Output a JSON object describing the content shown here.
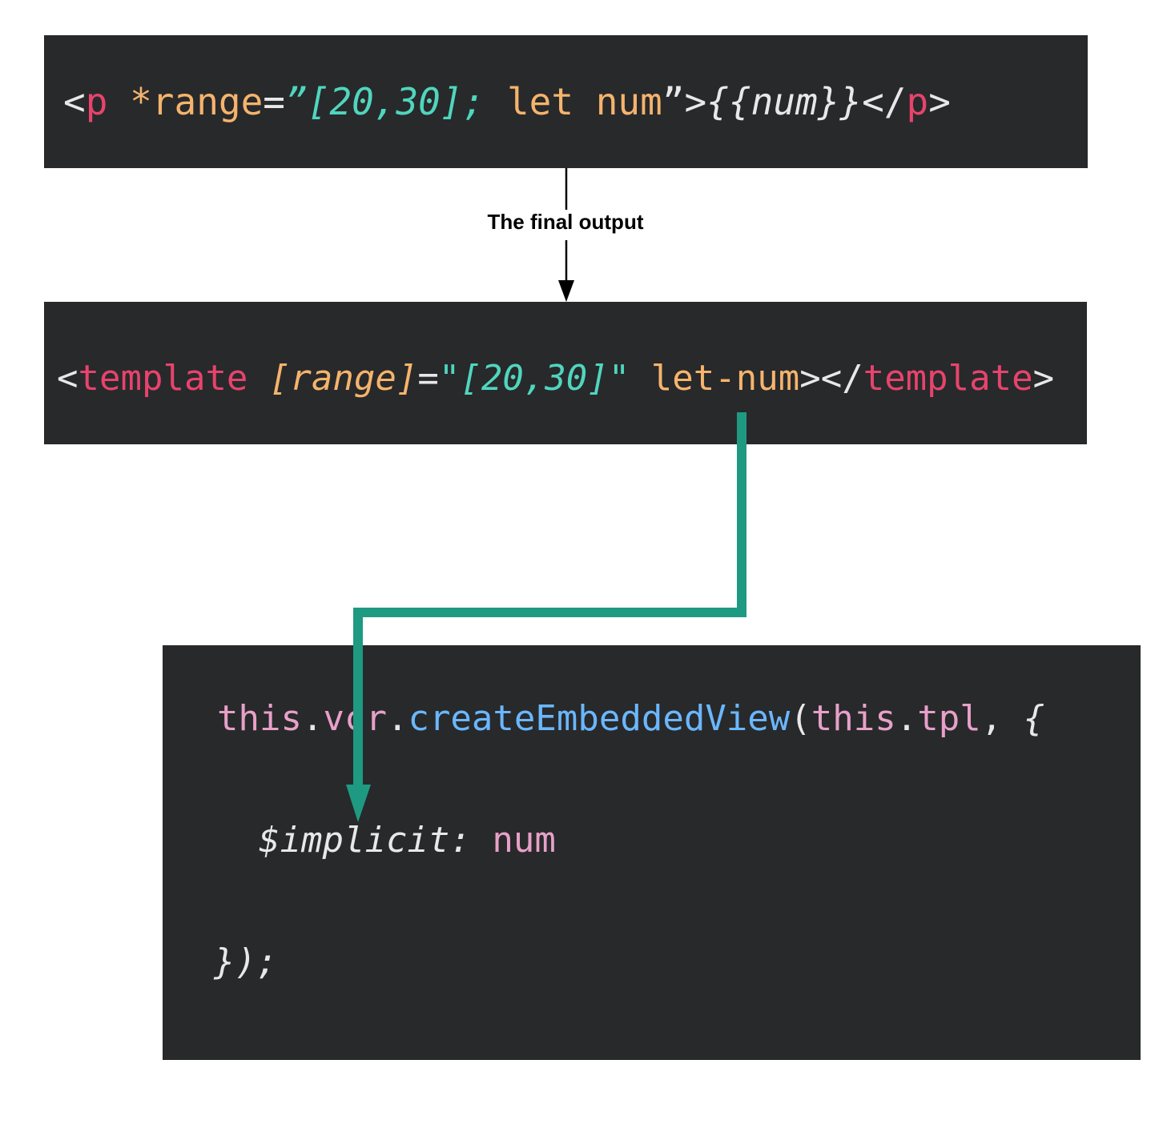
{
  "colors": {
    "background": "#ffffff",
    "code_bg": "#28292b",
    "punct": "#e8e8e8",
    "tag": "#e8436d",
    "attr": "#f5b46c",
    "string": "#4fd6be",
    "keyword": "#f5b46c",
    "this": "#e8a0c8",
    "method": "#6ab7ff",
    "plain": "#e8e8e8",
    "connector": "#1e9a82",
    "arrow": "#000000"
  },
  "top_code": {
    "tokens": [
      "<",
      "p",
      " ",
      "*range",
      "=",
      "”[20,30]; ",
      "let",
      " ",
      "num",
      "”",
      ">",
      "{{num}}",
      "</",
      "p",
      ">"
    ]
  },
  "middle_code": {
    "tokens": [
      "<",
      "template",
      " ",
      "[range]",
      "=",
      "\"[20,30]\"",
      " ",
      "let-num",
      "></",
      "template",
      ">"
    ]
  },
  "bottom_code": {
    "line1": [
      "this",
      ".",
      "vcr",
      ".",
      "createEmbeddedView",
      "(",
      "this",
      ".",
      "tpl",
      ", ",
      "{"
    ],
    "line2": [
      "$implicit:",
      " ",
      "num"
    ],
    "line3": [
      "});"
    ]
  },
  "caption": "The final output"
}
